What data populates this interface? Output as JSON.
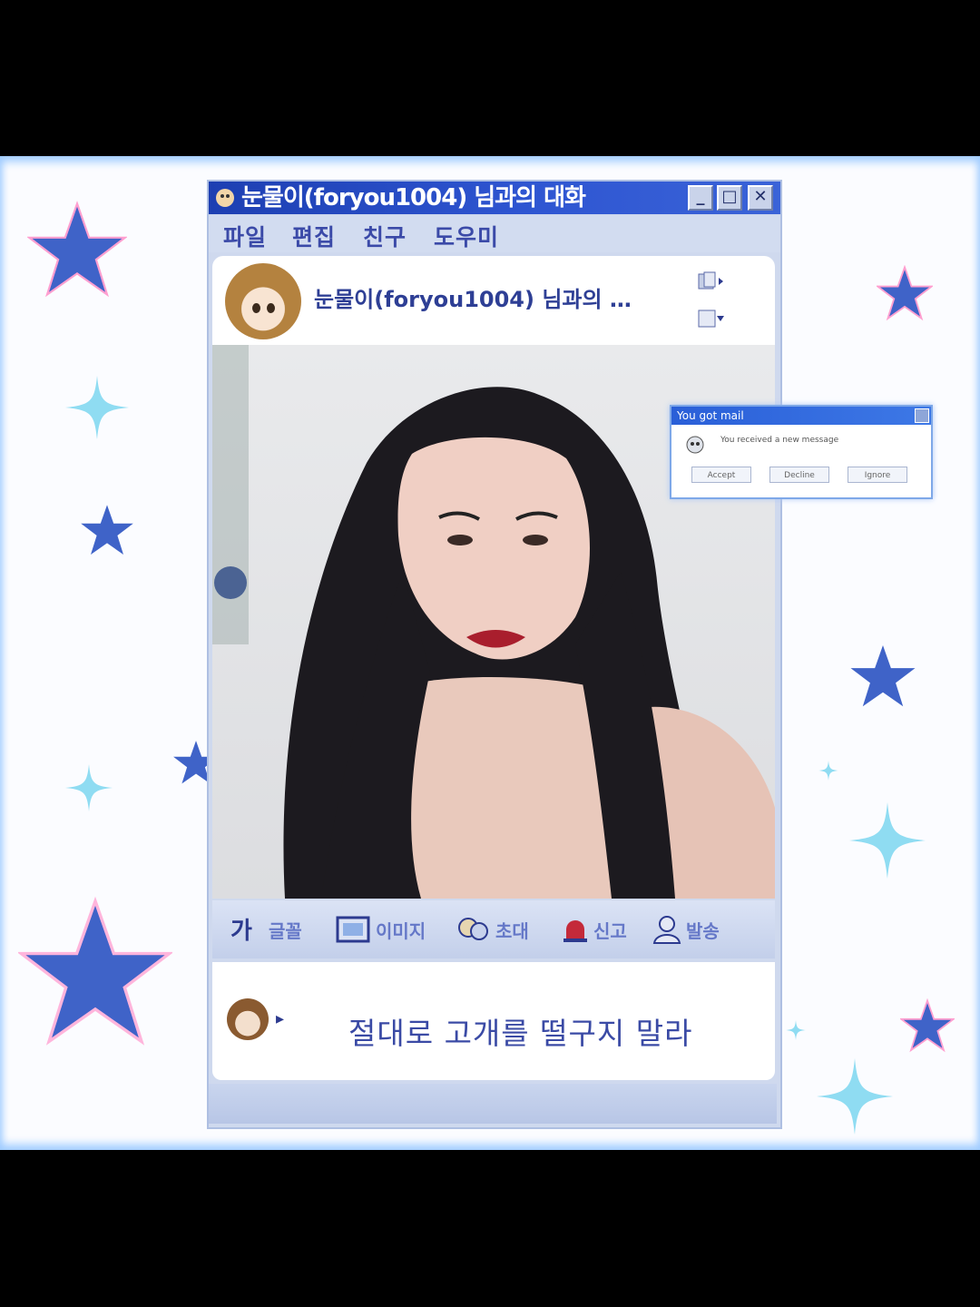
{
  "window": {
    "title": "눈물이(foryou1004) 님과의 대화",
    "controls": [
      "minimize",
      "maximize",
      "close"
    ]
  },
  "menu": [
    "파일",
    "편집",
    "친구",
    "도우미"
  ],
  "header": {
    "name": "눈물이(foryou1004) 님과의 …"
  },
  "toolbar": {
    "buttons": [
      {
        "icon": "font-icon",
        "label": "글꼴"
      },
      {
        "icon": "image-icon",
        "label": "이미지"
      },
      {
        "icon": "invite-icon",
        "label": "초대"
      },
      {
        "icon": "alert-icon",
        "label": "신고"
      },
      {
        "icon": "block-icon",
        "label": "발송"
      }
    ]
  },
  "chat": {
    "message": "절대로 고개를 떨구지 말라"
  },
  "popup": {
    "title": "You got mail",
    "message": "You received a new message",
    "buttons": [
      "Accept",
      "Decline",
      "Ignore"
    ]
  },
  "colors": {
    "titlebar": "#1d3fb2",
    "star_dark": "#3f63c8",
    "star_light": "#8fdcf2",
    "background": "#fbfcff"
  }
}
